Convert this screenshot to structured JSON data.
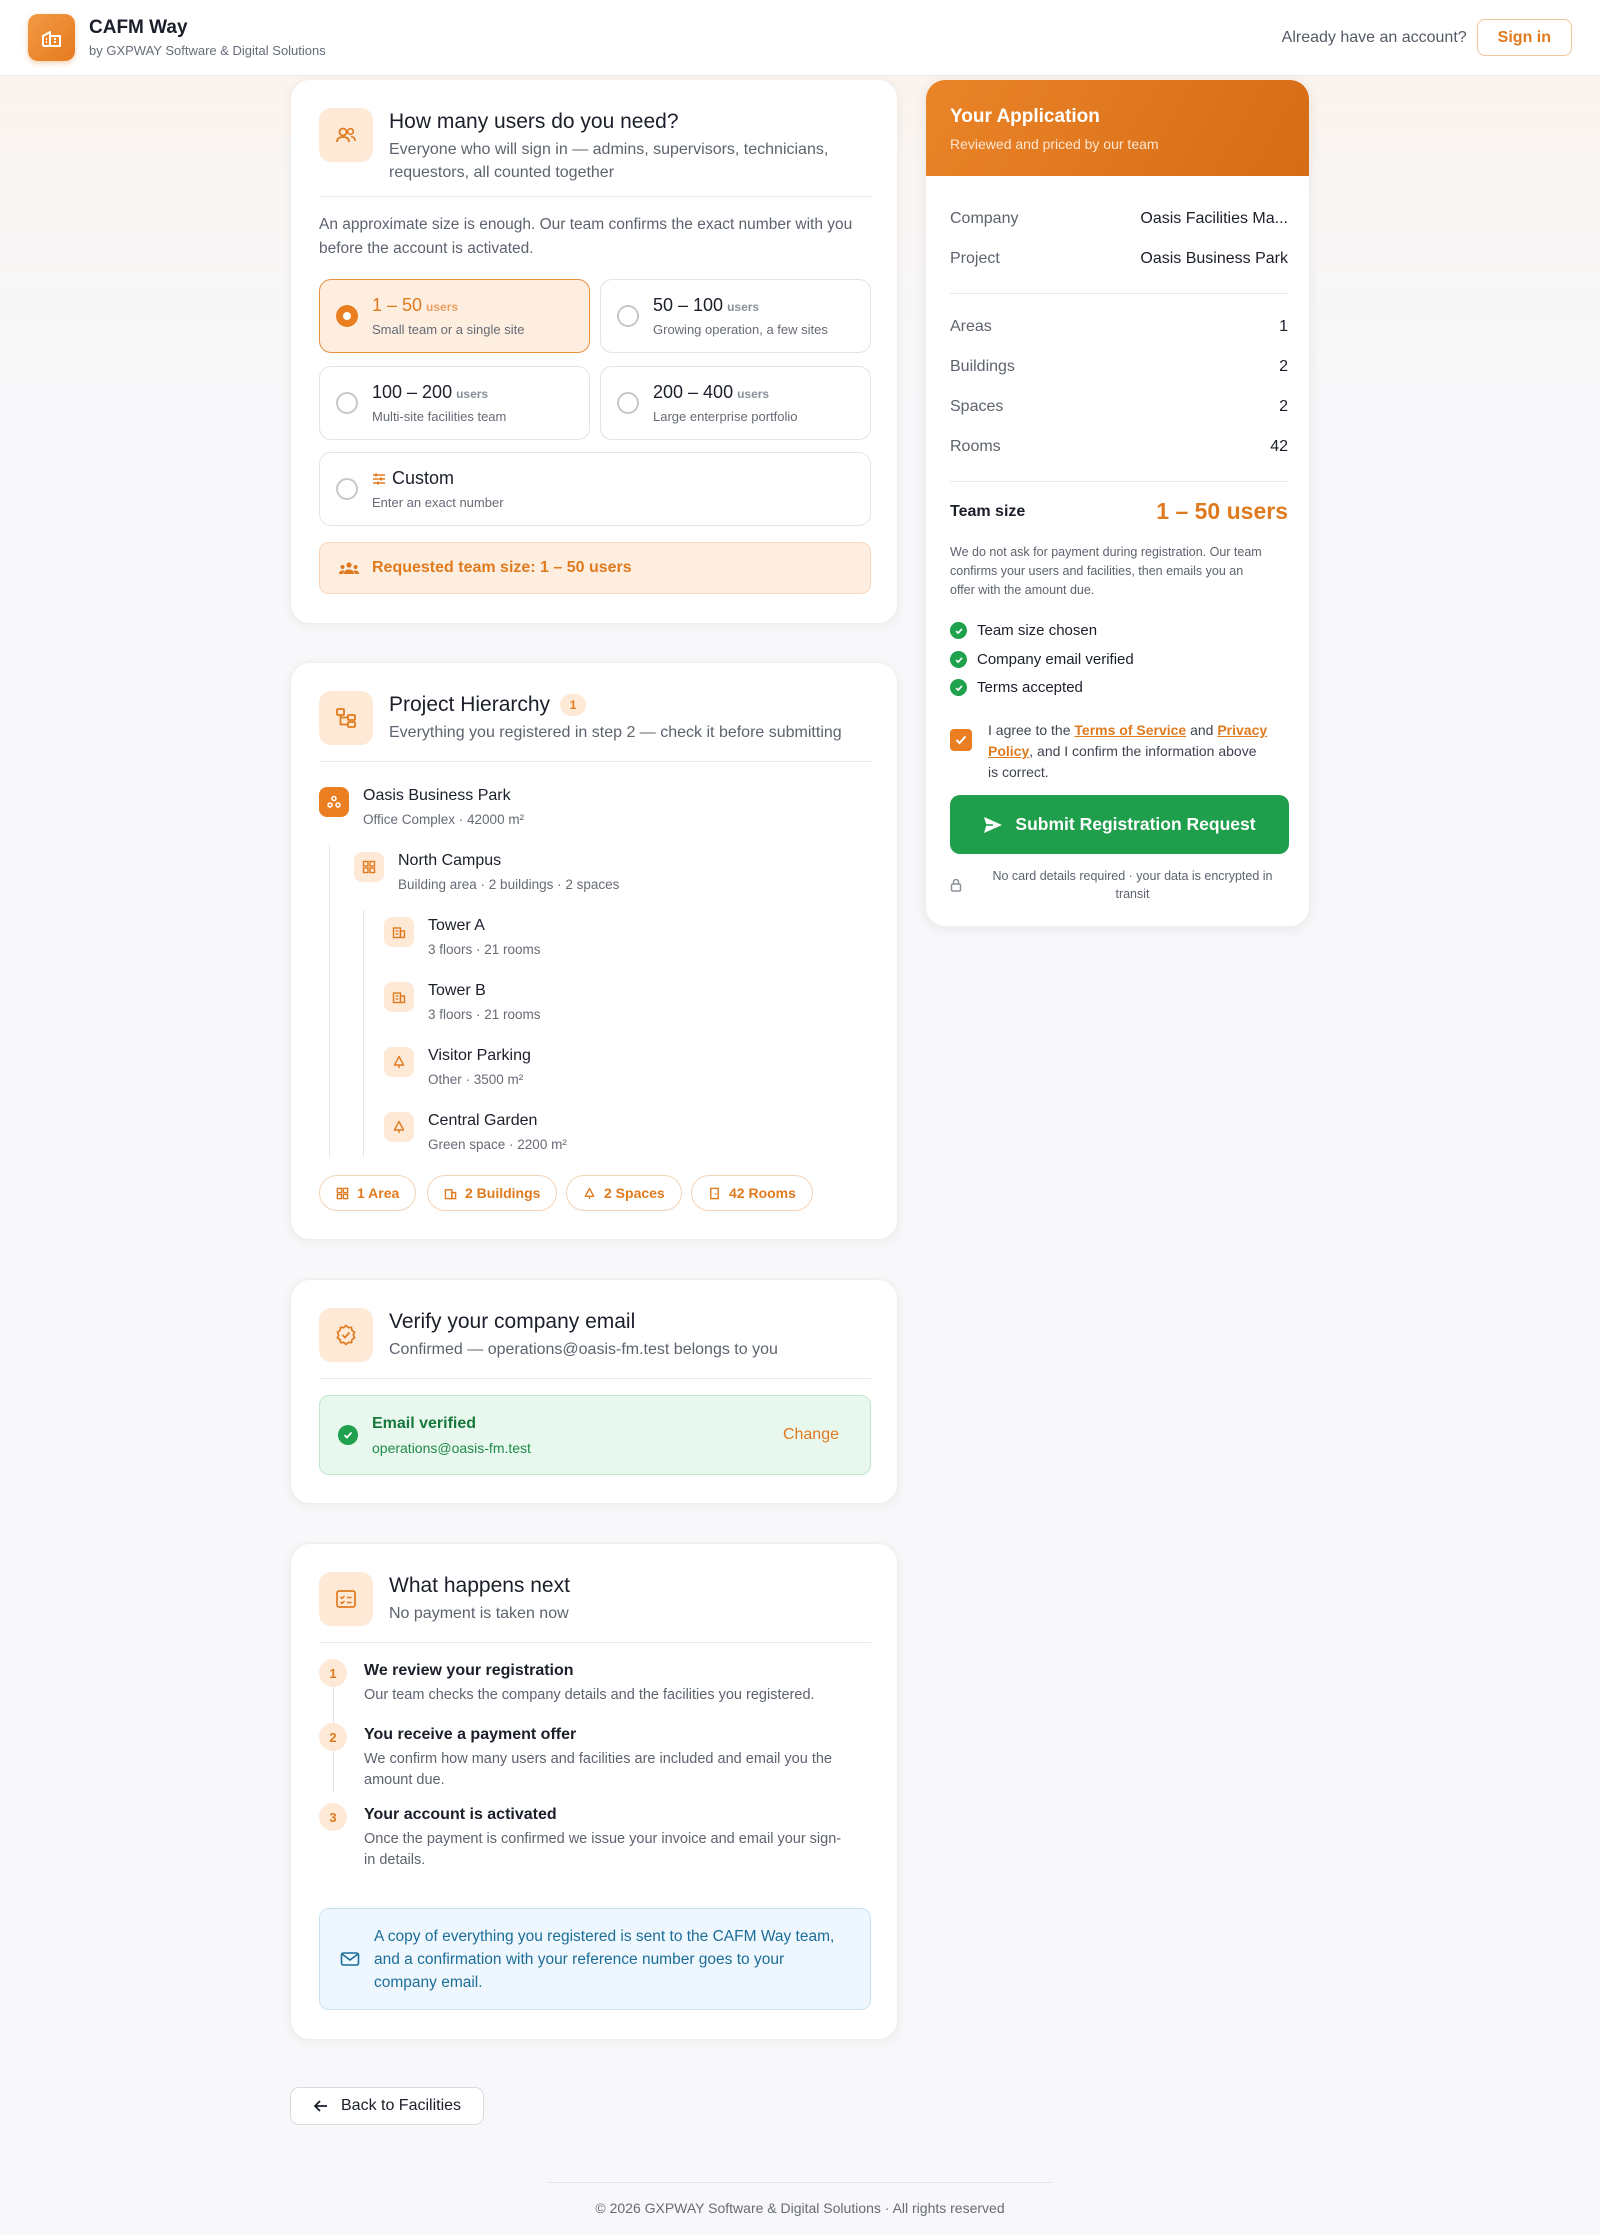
{
  "header": {
    "brand_name": "CAFM Way",
    "brand_sub": "by GXPWAY Software & Digital Solutions",
    "already_text": "Already have an account?",
    "sign_in": "Sign in"
  },
  "team_size": {
    "title": "How many users do you need?",
    "subtitle_line1": "Everyone who will sign in — admins, supervisors, technicians,",
    "subtitle_line2": "requestors, all counted together",
    "note_line1": "An approximate size is enough. Our team confirms the exact number with you",
    "note_line2": "before the account is activated.",
    "options": [
      {
        "range": "1 – 50",
        "unit": "users",
        "desc": "Small team or a single site",
        "selected": true
      },
      {
        "range": "50 – 100",
        "unit": "users",
        "desc": "Growing operation, a few sites",
        "selected": false
      },
      {
        "range": "100 – 200",
        "unit": "users",
        "desc": "Multi-site facilities team",
        "selected": false
      },
      {
        "range": "200 – 400",
        "unit": "users",
        "desc": "Large enterprise portfolio",
        "selected": false
      },
      {
        "range": "Custom",
        "unit": "",
        "desc": "Enter an exact number",
        "selected": false
      }
    ],
    "requested_label": "Requested team size: 1 – 50 users"
  },
  "hierarchy": {
    "title": "Project Hierarchy",
    "count": "1",
    "subtitle": "Everything you registered in step 2 — check it before submitting",
    "project": {
      "name": "Oasis Business Park",
      "meta": "Office Complex · 42000 m²"
    },
    "area": {
      "name": "North Campus",
      "meta": "Building area · 2 buildings · 2 spaces"
    },
    "children": [
      {
        "name": "Tower A",
        "meta": "3 floors · 21 rooms",
        "icon": "building-icon"
      },
      {
        "name": "Tower B",
        "meta": "3 floors · 21 rooms",
        "icon": "building-icon"
      },
      {
        "name": "Visitor Parking",
        "meta": "Other · 3500 m²",
        "icon": "tree-icon"
      },
      {
        "name": "Central Garden",
        "meta": "Green space · 2200 m²",
        "icon": "tree-icon"
      }
    ],
    "pills": [
      "1 Area",
      "2 Buildings",
      "2 Spaces",
      "42 Rooms"
    ]
  },
  "email": {
    "title": "Verify your company email",
    "subtitle": "Confirmed — operations@oasis-fm.test belongs to you",
    "verified_label": "Email verified",
    "address": "operations@oasis-fm.test",
    "change": "Change"
  },
  "next": {
    "title": "What happens next",
    "subtitle": "No payment is taken now",
    "steps": [
      {
        "num": "1",
        "title": "We review your registration",
        "desc_line1": "Our team checks the company details and the facilities you registered.",
        "desc_line2": ""
      },
      {
        "num": "2",
        "title": "You receive a payment offer",
        "desc_line1": "We confirm how many users and facilities are included and email you the",
        "desc_line2": "amount due."
      },
      {
        "num": "3",
        "title": "Your account is activated",
        "desc_line1": "Once the payment is confirmed we issue your invoice and email your sign-",
        "desc_line2": "in details."
      }
    ],
    "info_line1": "A copy of everything you registered is sent to the CAFM Way team,",
    "info_line2": "and a confirmation with your reference number goes to your",
    "info_line3": "company email."
  },
  "back_button": "Back to Facilities",
  "application": {
    "title": "Your Application",
    "subtitle": "Reviewed and priced by our team",
    "company_label": "Company",
    "company_value": "Oasis Facilities Ma...",
    "project_label": "Project",
    "project_value": "Oasis Business Park",
    "stats": [
      {
        "label": "Areas",
        "value": "1"
      },
      {
        "label": "Buildings",
        "value": "2"
      },
      {
        "label": "Spaces",
        "value": "2"
      },
      {
        "label": "Rooms",
        "value": "42"
      }
    ],
    "team_label": "Team size",
    "team_value": "1 – 50 users",
    "payment_note_line1": "We do not ask for payment during registration. Our team",
    "payment_note_line2": "confirms your users and facilities, then emails you an",
    "payment_note_line3": "offer with the amount due.",
    "checks": [
      "Team size chosen",
      "Company email verified",
      "Terms accepted"
    ],
    "agree_prefix": "I agree to the ",
    "terms_link": "Terms of Service",
    "agree_and": " and ",
    "privacy_link_1": "Privacy",
    "privacy_link_2": "Policy",
    "agree_suffix_1": ", and I confirm the information above",
    "agree_suffix_2": "is correct.",
    "submit": "Submit Registration Request",
    "secure_line1": "No card details required · your data is encrypted in",
    "secure_line2": "transit"
  },
  "footer": "© 2026 GXPWAY Software & Digital Solutions · All rights reserved",
  "colors": {
    "accent": "#ea7f22",
    "success": "#1f9f4c",
    "info": "#1d6d99"
  }
}
